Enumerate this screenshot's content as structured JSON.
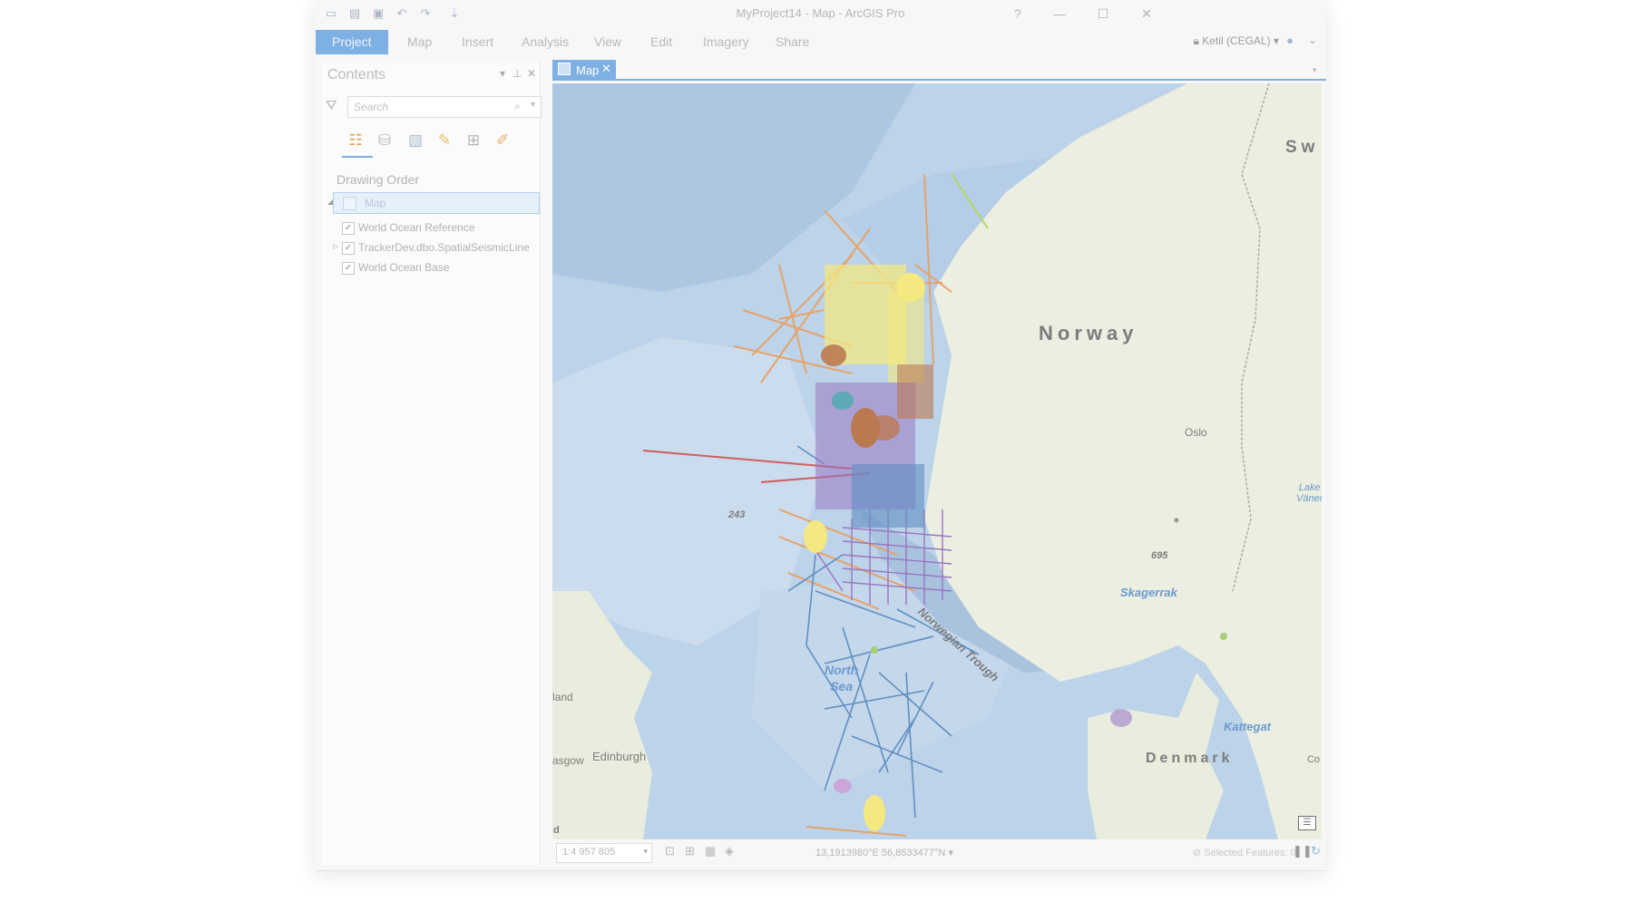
{
  "window": {
    "title": "MyProject14 - Map - ArcGIS Pro",
    "quick_access_icons": [
      "new-project-icon",
      "open-project-icon",
      "save-project-icon",
      "undo-icon",
      "redo-icon",
      "customize-icon"
    ],
    "controls": {
      "help": "?",
      "minimize": "—",
      "maximize": "☐",
      "close": "✕"
    }
  },
  "ribbon": {
    "tabs": [
      "Project",
      "Map",
      "Insert",
      "Analysis",
      "View",
      "Edit",
      "Imagery",
      "Share"
    ],
    "active_tab": "Project",
    "user": "Ketil (CEGAL)"
  },
  "contents": {
    "title": "Contents",
    "search_placeholder": "Search",
    "tool_icons": [
      "list-by-drawing-order-icon",
      "list-by-data-source-icon",
      "list-by-selection-icon",
      "list-by-editing-icon",
      "list-by-snapping-icon",
      "list-by-labeling-icon"
    ],
    "drawing_order_label": "Drawing Order",
    "map_node": "Map",
    "layers": [
      {
        "name": "World Ocean Reference",
        "checked": true
      },
      {
        "name": "TrackerDev.dbo.SpatialSeismicLine",
        "checked": true
      },
      {
        "name": "World Ocean Base",
        "checked": true
      }
    ]
  },
  "map_view": {
    "tab_label": "Map",
    "labels": {
      "country_norway": "Norway",
      "country_sweden": "Sw",
      "country_denmark": "Denmark",
      "city_oslo": "Oslo",
      "lake_vaner": "Lake\nVäner",
      "depth_243": "243",
      "depth_695": "695",
      "norwegian_trough": "Norwegian Trough",
      "skagerrak": "Skagerrak",
      "kattegat": "Kattegat",
      "north_sea": "North\nSea",
      "edinburgh": "Edinburgh",
      "glasgow": "asgow",
      "scotland": "land",
      "copenhagen": "Co",
      "corner_letter": "d"
    },
    "colors": {
      "ocean": "#a9c7e5",
      "shelf": "#bcd3ea",
      "deep": "#95b7dc",
      "land": "#e7ebd9",
      "seismic_blue": "#2f6db0",
      "seismic_orange": "#e0873c",
      "seismic_yellow": "#f3e45a",
      "seismic_purple": "#7a4bb0",
      "seismic_brown": "#a8501c",
      "seismic_red": "#c22b2b",
      "seismic_teal": "#2a8fa0"
    }
  },
  "status_bar": {
    "scale": "1:4 957 805",
    "coordinates": "13,1913980°E 56,8533477°N",
    "selected_features": "Selected Features: 0"
  }
}
